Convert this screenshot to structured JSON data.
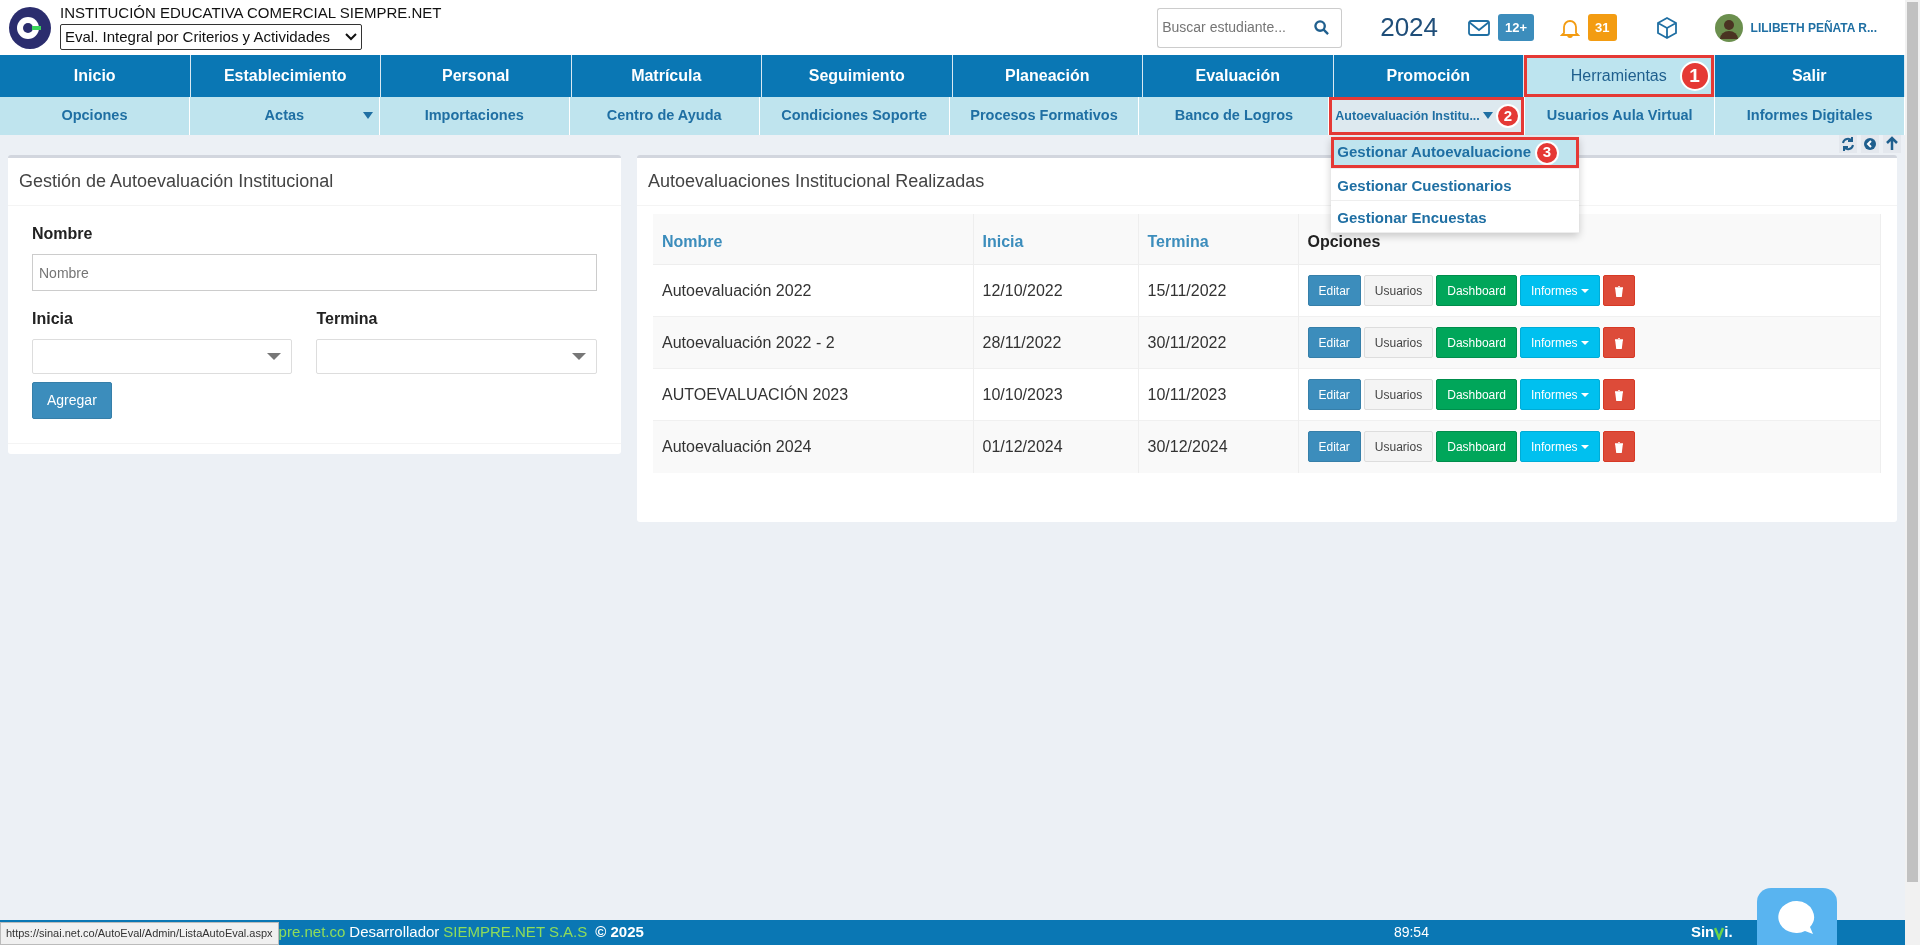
{
  "header": {
    "institution": "INSTITUCIÓN EDUCATIVA COMERCIAL SIEMPRE.NET",
    "program": "Eval. Integral por Criterios y Actividades",
    "search": {
      "placeholder": "Buscar estudiante..."
    },
    "year": "2024",
    "messages_badge": "12+",
    "notifications_badge": "31",
    "user_name": "LILIBETH PEÑATA R..."
  },
  "main_nav": [
    {
      "label": "Inicio",
      "selected": false
    },
    {
      "label": "Establecimiento",
      "selected": false
    },
    {
      "label": "Personal",
      "selected": false
    },
    {
      "label": "Matrícula",
      "selected": false
    },
    {
      "label": "Seguimiento",
      "selected": false
    },
    {
      "label": "Planeación",
      "selected": false
    },
    {
      "label": "Evaluación",
      "selected": false
    },
    {
      "label": "Promoción",
      "selected": false
    },
    {
      "label": "Herramientas",
      "selected": true,
      "callout": "1"
    },
    {
      "label": "Salir",
      "selected": false
    }
  ],
  "sub_nav": [
    {
      "label": "Opciones",
      "selected": false
    },
    {
      "label": "Actas",
      "selected": false,
      "caret": true
    },
    {
      "label": "Importaciones",
      "selected": false
    },
    {
      "label": "Centro de Ayuda",
      "selected": false
    },
    {
      "label": "Condiciones Soporte",
      "selected": false
    },
    {
      "label": "Procesos Formativos",
      "selected": false
    },
    {
      "label": "Banco de Logros",
      "selected": false
    },
    {
      "label": "Autoevaluación Institu...",
      "selected": true,
      "caret": true,
      "callout": "2",
      "menu": [
        {
          "label": "Gestionar Autoevaluacione",
          "selected": true,
          "callout": "3"
        },
        {
          "label": "Gestionar Cuestionarios",
          "selected": false
        },
        {
          "label": "Gestionar Encuestas",
          "selected": false
        }
      ]
    },
    {
      "label": "Usuarios Aula Virtual",
      "selected": false
    },
    {
      "label": "Informes Digitales",
      "selected": false
    }
  ],
  "form_card": {
    "title": "Gestión de Autoevaluación Institucional",
    "name_label": "Nombre",
    "name_placeholder": "Nombre",
    "start_label": "Inicia",
    "end_label": "Termina",
    "submit": "Agregar"
  },
  "table_card": {
    "title": "Autoevaluaciones Institucional Realizadas",
    "columns": [
      {
        "label": "Nombre",
        "sortable": true
      },
      {
        "label": "Inicia",
        "sortable": true
      },
      {
        "label": "Termina",
        "sortable": true
      },
      {
        "label": "Opciones",
        "sortable": false
      }
    ],
    "rows": [
      {
        "cells": [
          "Autoevaluación 2022",
          "12/10/2022",
          "15/11/2022"
        ],
        "actions": [
          {
            "kind": "edit",
            "label": "Editar"
          },
          {
            "kind": "default",
            "label": "Usuarios"
          },
          {
            "kind": "success",
            "label": "Dashboard"
          },
          {
            "kind": "info",
            "label": "Informes"
          },
          {
            "kind": "delete"
          }
        ]
      },
      {
        "cells": [
          "Autoevaluación 2022 - 2",
          "28/11/2022",
          "30/11/2022"
        ],
        "actions": [
          {
            "kind": "edit",
            "label": "Editar"
          },
          {
            "kind": "default",
            "label": "Usuarios"
          },
          {
            "kind": "success",
            "label": "Dashboard"
          },
          {
            "kind": "info",
            "label": "Informes"
          },
          {
            "kind": "delete"
          }
        ]
      },
      {
        "cells": [
          "AUTOEVALUACIÓN 2023",
          "10/10/2023",
          "10/11/2023"
        ],
        "actions": [
          {
            "kind": "edit",
            "label": "Editar"
          },
          {
            "kind": "default",
            "label": "Usuarios"
          },
          {
            "kind": "success",
            "label": "Dashboard"
          },
          {
            "kind": "info",
            "label": "Informes"
          },
          {
            "kind": "delete"
          }
        ]
      },
      {
        "cells": [
          "Autoevaluación 2024",
          "01/12/2024",
          "30/12/2024"
        ],
        "actions": [
          {
            "kind": "edit",
            "label": "Editar"
          },
          {
            "kind": "default",
            "label": "Usuarios"
          },
          {
            "kind": "success",
            "label": "Dashboard"
          },
          {
            "kind": "info",
            "label": "Informes"
          },
          {
            "kind": "delete"
          }
        ]
      }
    ]
  },
  "footer": {
    "url_tooltip": "https://sinai.net.co/AutoEval/Admin/ListaAutoEval.aspx",
    "site": "pre.net.co",
    "developer_label": "Desarrollador",
    "developer": "SIEMPRE.NET S.A.S",
    "copyright": "© 2025",
    "timer": "89:54",
    "logo_start": "Sin",
    "logo_end": "i."
  }
}
